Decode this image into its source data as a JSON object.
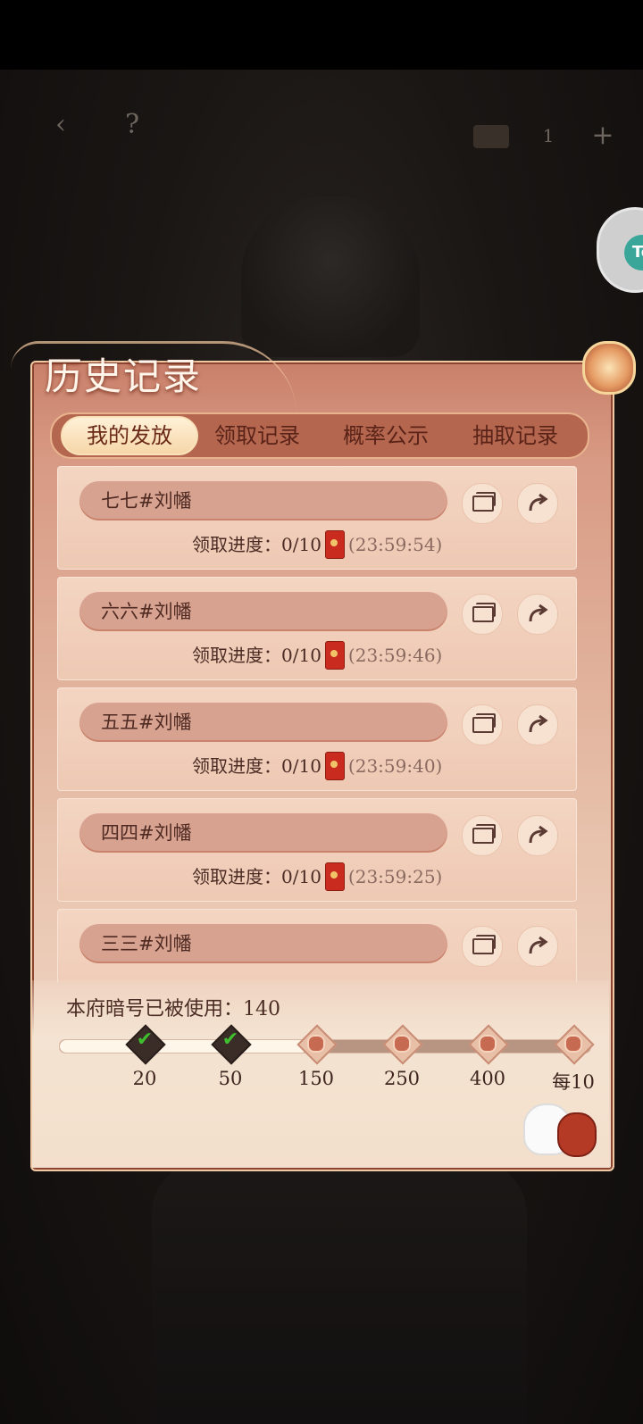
{
  "hud": {
    "back_icon": "back-arrow-icon",
    "help_label": "?",
    "counter": "1",
    "plus_label": "+"
  },
  "panel": {
    "title": "历史记录"
  },
  "tabs": [
    {
      "label": "我的发放",
      "active": true
    },
    {
      "label": "领取记录",
      "active": false
    },
    {
      "label": "概率公示",
      "active": false
    },
    {
      "label": "抽取记录",
      "active": false
    }
  ],
  "records": [
    {
      "name": "七七#刘幡",
      "progress_label": "领取进度：",
      "progress": "0/10",
      "timer": "(23:59:54)"
    },
    {
      "name": "六六#刘幡",
      "progress_label": "领取进度：",
      "progress": "0/10",
      "timer": "(23:59:46)"
    },
    {
      "name": "五五#刘幡",
      "progress_label": "领取进度：",
      "progress": "0/10",
      "timer": "(23:59:40)"
    },
    {
      "name": "四四#刘幡",
      "progress_label": "领取进度：",
      "progress": "0/10",
      "timer": "(23:59:25)"
    },
    {
      "name": "三三#刘幡",
      "progress_label": "",
      "progress": "",
      "timer": ""
    }
  ],
  "usage": {
    "label": "本府暗号已被使用：140",
    "used": 140,
    "milestones": [
      {
        "label": "20",
        "reached": true
      },
      {
        "label": "50",
        "reached": true
      },
      {
        "label": "150",
        "reached": false
      },
      {
        "label": "250",
        "reached": false
      },
      {
        "label": "400",
        "reached": false
      },
      {
        "label": "每10",
        "reached": false
      }
    ]
  },
  "colors": {
    "accent": "#c92b1e",
    "panel": "#e8c3ad",
    "text": "#4b2c24",
    "check": "#3fbf2f"
  }
}
